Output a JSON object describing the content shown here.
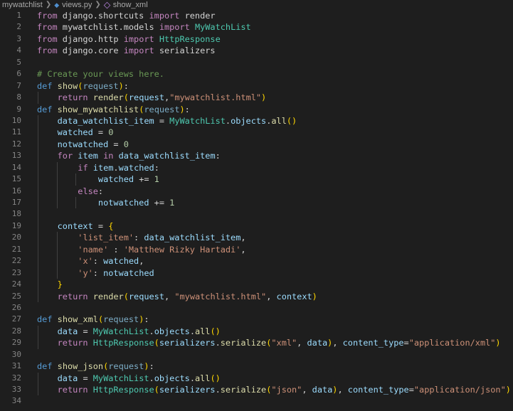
{
  "breadcrumb": {
    "folder": "mywatchlist",
    "file": "views.py",
    "symbol": "show_xml"
  },
  "lines": [
    {
      "n": "1",
      "indent": 0,
      "tokens": [
        [
          "kw2",
          "from"
        ],
        [
          "pl",
          " django.shortcuts "
        ],
        [
          "kw2",
          "import"
        ],
        [
          "pl",
          " render"
        ]
      ]
    },
    {
      "n": "2",
      "indent": 0,
      "tokens": [
        [
          "kw2",
          "from"
        ],
        [
          "pl",
          " mywatchlist.models "
        ],
        [
          "kw2",
          "import"
        ],
        [
          "pl",
          " "
        ],
        [
          "cls",
          "MyWatchList"
        ]
      ]
    },
    {
      "n": "3",
      "indent": 0,
      "tokens": [
        [
          "kw2",
          "from"
        ],
        [
          "pl",
          " django.http "
        ],
        [
          "kw2",
          "import"
        ],
        [
          "pl",
          " "
        ],
        [
          "cls",
          "HttpResponse"
        ]
      ]
    },
    {
      "n": "4",
      "indent": 0,
      "tokens": [
        [
          "kw2",
          "from"
        ],
        [
          "pl",
          " django.core "
        ],
        [
          "kw2",
          "import"
        ],
        [
          "pl",
          " serializers"
        ]
      ]
    },
    {
      "n": "5",
      "indent": 0,
      "tokens": []
    },
    {
      "n": "6",
      "indent": 0,
      "tokens": [
        [
          "cmt",
          "# Create your views here."
        ]
      ]
    },
    {
      "n": "7",
      "indent": 0,
      "tokens": [
        [
          "kw",
          "def"
        ],
        [
          "pl",
          " "
        ],
        [
          "fn",
          "show"
        ],
        [
          "brk",
          "("
        ],
        [
          "prm",
          "request"
        ],
        [
          "brk",
          ")"
        ],
        [
          "pl",
          ":"
        ]
      ]
    },
    {
      "n": "8",
      "indent": 1,
      "tokens": [
        [
          "pl",
          "    "
        ],
        [
          "kw2",
          "return"
        ],
        [
          "pl",
          " "
        ],
        [
          "fn",
          "render"
        ],
        [
          "brk",
          "("
        ],
        [
          "var",
          "request"
        ],
        [
          "pl",
          ","
        ],
        [
          "str",
          "\"mywatchlist.html\""
        ],
        [
          "brk",
          ")"
        ]
      ]
    },
    {
      "n": "9",
      "indent": 0,
      "tokens": [
        [
          "kw",
          "def"
        ],
        [
          "pl",
          " "
        ],
        [
          "fn",
          "show_mywatchlist"
        ],
        [
          "brk",
          "("
        ],
        [
          "prm",
          "request"
        ],
        [
          "brk",
          ")"
        ],
        [
          "pl",
          ":"
        ]
      ]
    },
    {
      "n": "10",
      "indent": 1,
      "tokens": [
        [
          "pl",
          "    "
        ],
        [
          "var",
          "data_watchlist_item"
        ],
        [
          "pl",
          " = "
        ],
        [
          "cls",
          "MyWatchList"
        ],
        [
          "pl",
          "."
        ],
        [
          "var",
          "objects"
        ],
        [
          "pl",
          "."
        ],
        [
          "fn",
          "all"
        ],
        [
          "brk",
          "()"
        ]
      ]
    },
    {
      "n": "11",
      "indent": 1,
      "tokens": [
        [
          "pl",
          "    "
        ],
        [
          "var",
          "watched"
        ],
        [
          "pl",
          " = "
        ],
        [
          "num",
          "0"
        ]
      ]
    },
    {
      "n": "12",
      "indent": 1,
      "tokens": [
        [
          "pl",
          "    "
        ],
        [
          "var",
          "notwatched"
        ],
        [
          "pl",
          " = "
        ],
        [
          "num",
          "0"
        ]
      ]
    },
    {
      "n": "13",
      "indent": 1,
      "tokens": [
        [
          "pl",
          "    "
        ],
        [
          "kw2",
          "for"
        ],
        [
          "pl",
          " "
        ],
        [
          "var",
          "item"
        ],
        [
          "pl",
          " "
        ],
        [
          "kw2",
          "in"
        ],
        [
          "pl",
          " "
        ],
        [
          "var",
          "data_watchlist_item"
        ],
        [
          "pl",
          ":"
        ]
      ]
    },
    {
      "n": "14",
      "indent": 2,
      "tokens": [
        [
          "pl",
          "        "
        ],
        [
          "kw2",
          "if"
        ],
        [
          "pl",
          " "
        ],
        [
          "var",
          "item"
        ],
        [
          "pl",
          "."
        ],
        [
          "var",
          "watched"
        ],
        [
          "pl",
          ":"
        ]
      ]
    },
    {
      "n": "15",
      "indent": 3,
      "tokens": [
        [
          "pl",
          "            "
        ],
        [
          "var",
          "watched"
        ],
        [
          "pl",
          " += "
        ],
        [
          "num",
          "1"
        ]
      ]
    },
    {
      "n": "16",
      "indent": 2,
      "tokens": [
        [
          "pl",
          "        "
        ],
        [
          "kw2",
          "else"
        ],
        [
          "pl",
          ":"
        ]
      ]
    },
    {
      "n": "17",
      "indent": 3,
      "tokens": [
        [
          "pl",
          "            "
        ],
        [
          "var",
          "notwatched"
        ],
        [
          "pl",
          " += "
        ],
        [
          "num",
          "1"
        ]
      ]
    },
    {
      "n": "18",
      "indent": 1,
      "tokens": []
    },
    {
      "n": "19",
      "indent": 1,
      "tokens": [
        [
          "pl",
          "    "
        ],
        [
          "var",
          "context"
        ],
        [
          "pl",
          " = "
        ],
        [
          "brk",
          "{"
        ]
      ]
    },
    {
      "n": "20",
      "indent": 2,
      "tokens": [
        [
          "pl",
          "        "
        ],
        [
          "str",
          "'list_item'"
        ],
        [
          "pl",
          ": "
        ],
        [
          "var",
          "data_watchlist_item"
        ],
        [
          "pl",
          ","
        ]
      ]
    },
    {
      "n": "21",
      "indent": 2,
      "tokens": [
        [
          "pl",
          "        "
        ],
        [
          "str",
          "'name'"
        ],
        [
          "pl",
          " : "
        ],
        [
          "str",
          "'Matthew Rizky Hartadi'"
        ],
        [
          "pl",
          ","
        ]
      ]
    },
    {
      "n": "22",
      "indent": 2,
      "tokens": [
        [
          "pl",
          "        "
        ],
        [
          "str",
          "'x'"
        ],
        [
          "pl",
          ": "
        ],
        [
          "var",
          "watched"
        ],
        [
          "pl",
          ","
        ]
      ]
    },
    {
      "n": "23",
      "indent": 2,
      "tokens": [
        [
          "pl",
          "        "
        ],
        [
          "str",
          "'y'"
        ],
        [
          "pl",
          ": "
        ],
        [
          "var",
          "notwatched"
        ]
      ]
    },
    {
      "n": "24",
      "indent": 1,
      "tokens": [
        [
          "pl",
          "    "
        ],
        [
          "brk",
          "}"
        ]
      ]
    },
    {
      "n": "25",
      "indent": 1,
      "tokens": [
        [
          "pl",
          "    "
        ],
        [
          "kw2",
          "return"
        ],
        [
          "pl",
          " "
        ],
        [
          "fn",
          "render"
        ],
        [
          "brk",
          "("
        ],
        [
          "var",
          "request"
        ],
        [
          "pl",
          ", "
        ],
        [
          "str",
          "\"mywatchlist.html\""
        ],
        [
          "pl",
          ", "
        ],
        [
          "var",
          "context"
        ],
        [
          "brk",
          ")"
        ]
      ]
    },
    {
      "n": "26",
      "indent": 0,
      "tokens": []
    },
    {
      "n": "27",
      "indent": 0,
      "tokens": [
        [
          "kw",
          "def"
        ],
        [
          "pl",
          " "
        ],
        [
          "fn",
          "show_xml"
        ],
        [
          "brk",
          "("
        ],
        [
          "prm",
          "request"
        ],
        [
          "brk",
          ")"
        ],
        [
          "pl",
          ":"
        ]
      ]
    },
    {
      "n": "28",
      "indent": 1,
      "tokens": [
        [
          "pl",
          "    "
        ],
        [
          "var",
          "data"
        ],
        [
          "pl",
          " = "
        ],
        [
          "cls",
          "MyWatchList"
        ],
        [
          "pl",
          "."
        ],
        [
          "var",
          "objects"
        ],
        [
          "pl",
          "."
        ],
        [
          "fn",
          "all"
        ],
        [
          "brk",
          "()"
        ]
      ]
    },
    {
      "n": "29",
      "indent": 1,
      "tokens": [
        [
          "pl",
          "    "
        ],
        [
          "kw2",
          "return"
        ],
        [
          "pl",
          " "
        ],
        [
          "cls",
          "HttpResponse"
        ],
        [
          "brk",
          "("
        ],
        [
          "var",
          "serializers"
        ],
        [
          "pl",
          "."
        ],
        [
          "fn",
          "serialize"
        ],
        [
          "brk",
          "("
        ],
        [
          "str",
          "\"xml\""
        ],
        [
          "pl",
          ", "
        ],
        [
          "var",
          "data"
        ],
        [
          "brk",
          ")"
        ],
        [
          "pl",
          ", "
        ],
        [
          "var",
          "content_type"
        ],
        [
          "pl",
          "="
        ],
        [
          "str",
          "\"application/xml\""
        ],
        [
          "brk",
          ")"
        ]
      ]
    },
    {
      "n": "30",
      "indent": 0,
      "tokens": []
    },
    {
      "n": "31",
      "indent": 0,
      "tokens": [
        [
          "kw",
          "def"
        ],
        [
          "pl",
          " "
        ],
        [
          "fn",
          "show_json"
        ],
        [
          "brk",
          "("
        ],
        [
          "prm",
          "request"
        ],
        [
          "brk",
          ")"
        ],
        [
          "pl",
          ":"
        ]
      ]
    },
    {
      "n": "32",
      "indent": 1,
      "tokens": [
        [
          "pl",
          "    "
        ],
        [
          "var",
          "data"
        ],
        [
          "pl",
          " = "
        ],
        [
          "cls",
          "MyWatchList"
        ],
        [
          "pl",
          "."
        ],
        [
          "var",
          "objects"
        ],
        [
          "pl",
          "."
        ],
        [
          "fn",
          "all"
        ],
        [
          "brk",
          "()"
        ]
      ]
    },
    {
      "n": "33",
      "indent": 1,
      "tokens": [
        [
          "pl",
          "    "
        ],
        [
          "kw2",
          "return"
        ],
        [
          "pl",
          " "
        ],
        [
          "cls",
          "HttpResponse"
        ],
        [
          "brk",
          "("
        ],
        [
          "var",
          "serializers"
        ],
        [
          "pl",
          "."
        ],
        [
          "fn",
          "serialize"
        ],
        [
          "brk",
          "("
        ],
        [
          "str",
          "\"json\""
        ],
        [
          "pl",
          ", "
        ],
        [
          "var",
          "data"
        ],
        [
          "brk",
          ")"
        ],
        [
          "pl",
          ", "
        ],
        [
          "var",
          "content_type"
        ],
        [
          "pl",
          "="
        ],
        [
          "str",
          "\"application/json\""
        ],
        [
          "brk",
          ")"
        ]
      ]
    },
    {
      "n": "34",
      "indent": 0,
      "tokens": []
    }
  ]
}
